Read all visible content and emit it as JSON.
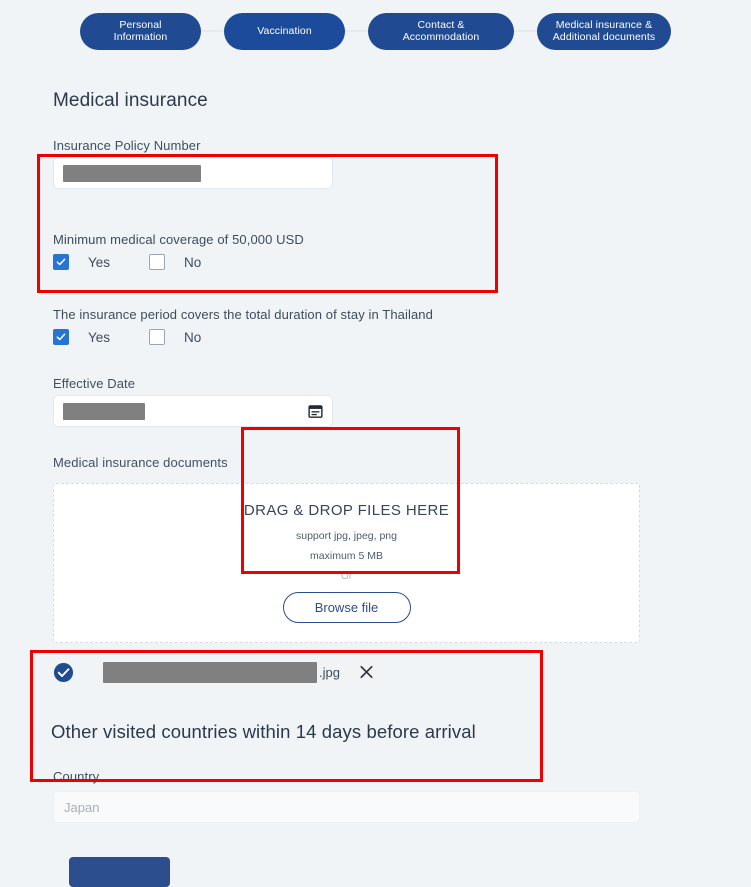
{
  "stepper": {
    "steps": [
      {
        "label": "Personal Information",
        "state": "completed"
      },
      {
        "label": "Vaccination",
        "state": "completed"
      },
      {
        "label": "Contact & Accommodation",
        "state": "completed"
      },
      {
        "label": "Medical insurance &\nAdditional documents",
        "state": "active"
      }
    ]
  },
  "form": {
    "title": "Medical insurance",
    "policy": {
      "label": "Insurance Policy Number",
      "value": "",
      "redacted": true
    },
    "coverage": {
      "question1": {
        "text": "Minimum medical coverage of 50,000 USD",
        "yes_label": "Yes",
        "no_label": "No",
        "yes_checked": true,
        "no_checked": false
      },
      "question2": {
        "text": "The insurance period covers the total duration of stay in Thailand",
        "yes_label": "Yes",
        "no_label": "No",
        "yes_checked": true,
        "no_checked": false
      }
    },
    "effective_date": {
      "label": "Effective Date",
      "value": "",
      "redacted": true,
      "icon": "calendar-icon"
    },
    "documents": {
      "label": "Medical insurance documents",
      "dropzone": {
        "title": "DRAG & DROP FILES HERE",
        "support": "support jpg, jpeg, png",
        "maximum": "maximum 5 MB",
        "or": "Or",
        "browse_label": "Browse file"
      },
      "uploaded_file": {
        "status_icon": "check-circle-icon",
        "name": "",
        "extension": ".jpg",
        "redacted": true,
        "remove_icon": "close-icon"
      }
    },
    "other_countries": {
      "title": "Other visited countries within 14 days before arrival",
      "country": {
        "label": "Country",
        "value": "",
        "placeholder": "Japan"
      }
    },
    "submit_label": ""
  },
  "annotations": {
    "highlight_color": "#ee0000",
    "boxes": [
      {
        "name": "coverage-questions"
      },
      {
        "name": "drag-drop-area"
      },
      {
        "name": "other-visited-countries"
      }
    ]
  },
  "theme": {
    "page_background": "#f0f4f7",
    "step_blue": "#204b92",
    "checkbox_blue": "#2874d1",
    "accent_navy": "#2c4d8e",
    "text_dark": "#2c394a"
  }
}
